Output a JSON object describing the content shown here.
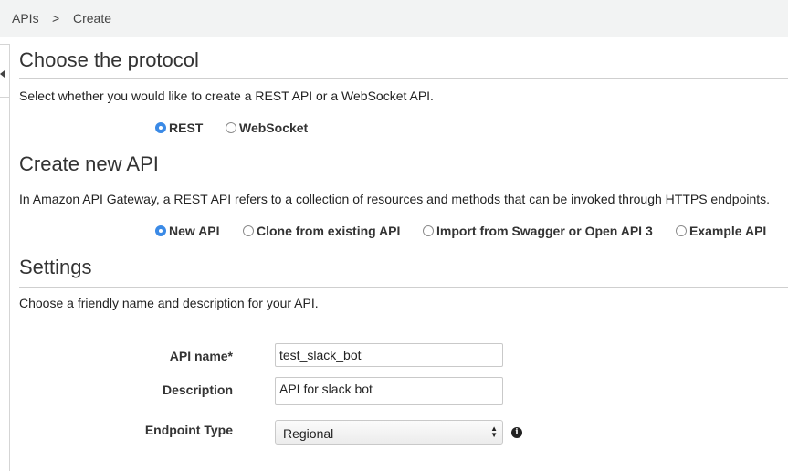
{
  "breadcrumb": {
    "root": "APIs",
    "separator": ">",
    "current": "Create"
  },
  "protocol": {
    "heading": "Choose the protocol",
    "description": "Select whether you would like to create a REST API or a WebSocket API.",
    "options": [
      {
        "label": "REST",
        "checked": true
      },
      {
        "label": "WebSocket",
        "checked": false
      }
    ]
  },
  "create": {
    "heading": "Create new API",
    "description": "In Amazon API Gateway, a REST API refers to a collection of resources and methods that can be invoked through HTTPS endpoints.",
    "options": [
      {
        "label": "New API",
        "checked": true
      },
      {
        "label": "Clone from existing API",
        "checked": false
      },
      {
        "label": "Import from Swagger or Open API 3",
        "checked": false
      },
      {
        "label": "Example API",
        "checked": false
      }
    ]
  },
  "settings": {
    "heading": "Settings",
    "description": "Choose a friendly name and description for your API.",
    "api_name_label": "API name*",
    "api_name_value": "test_slack_bot",
    "description_label": "Description",
    "description_value": "API for slack bot",
    "endpoint_label": "Endpoint Type",
    "endpoint_value": "Regional",
    "info_glyph": "i"
  },
  "colors": {
    "accent": "#3b8ae6",
    "topbar": "#f2f3f3"
  }
}
